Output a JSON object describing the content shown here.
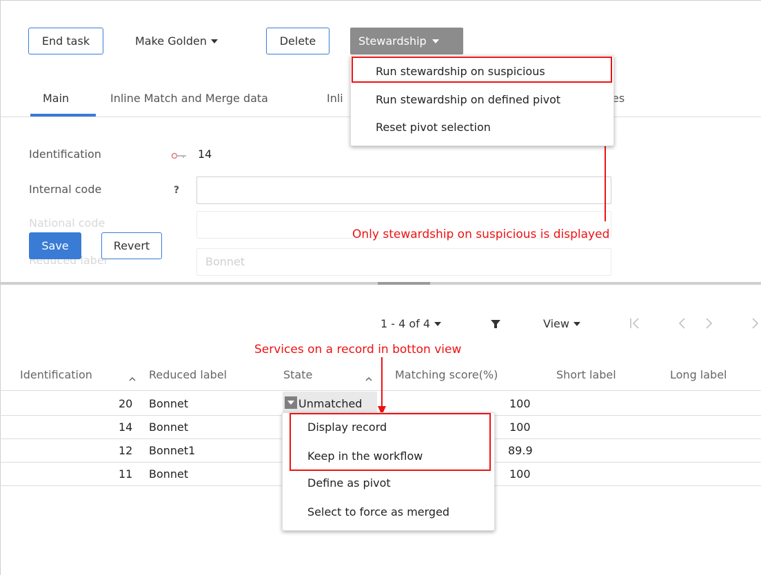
{
  "toolbar": {
    "end_task": "End task",
    "make_golden": "Make Golden",
    "delete": "Delete",
    "stewardship": "Stewardship"
  },
  "tabs": [
    "Main",
    "Inline Match and Merge data",
    "Inli",
    "es"
  ],
  "stewardship_menu": {
    "items": [
      "Run stewardship on suspicious",
      "Run stewardship on defined pivot",
      "Reset pivot selection"
    ]
  },
  "form": {
    "identification_label": "Identification",
    "identification_value": "14",
    "internal_code_label": "Internal code",
    "help_mark": "?",
    "internal_code_value": "",
    "national_code_label": "National code",
    "reduced_label_label": "Reduced label",
    "reduced_label_value": "Bonnet",
    "save": "Save",
    "revert": "Revert"
  },
  "annotations": {
    "top": "Only stewardship on suspicious is displayed",
    "bottom": "Services on a record in botton view"
  },
  "pager": {
    "range": "1 - 4 of 4",
    "view": "View"
  },
  "table": {
    "headers": [
      "Identification",
      "Reduced label",
      "State",
      "Matching score(%)",
      "Short label",
      "Long label"
    ],
    "rows": [
      {
        "id": "20",
        "label": "Bonnet",
        "state": "Unmatched",
        "score": "100",
        "state_color": "#e9e9e9"
      },
      {
        "id": "14",
        "label": "Bonnet",
        "state": "",
        "score": "100",
        "state_color": "#dff3f1"
      },
      {
        "id": "12",
        "label": "Bonnet1",
        "state": "",
        "score": "89.9",
        "state_color": "#e6e1fb"
      },
      {
        "id": "11",
        "label": "Bonnet",
        "state": "",
        "score": "100",
        "state_color": "#fbf7d6"
      }
    ]
  },
  "record_menu": {
    "items": [
      "Display record",
      "Keep in the workflow",
      "Define as pivot",
      "Select to force as merged"
    ]
  },
  "colors": {
    "accent": "#3a7bd5",
    "annotation": "#ee1111",
    "stewardship_bg": "#8c8c8c"
  }
}
